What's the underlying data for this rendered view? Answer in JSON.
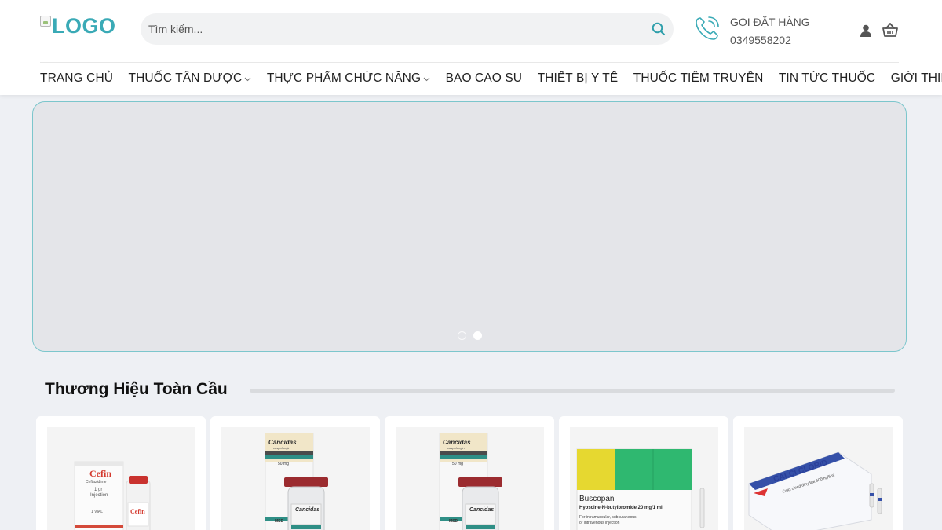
{
  "header": {
    "logo_text": "LOGO",
    "search": {
      "placeholder": "Tìm kiếm..."
    },
    "call": {
      "label": "GỌI ĐẶT HÀNG",
      "phone": "0349558202"
    }
  },
  "nav": [
    {
      "label": "TRANG CHỦ",
      "has_dropdown": false
    },
    {
      "label": "THUỐC TÂN DƯỢC",
      "has_dropdown": true
    },
    {
      "label": "THỰC PHẨM CHỨC NĂNG",
      "has_dropdown": true
    },
    {
      "label": "BAO CAO SU",
      "has_dropdown": false
    },
    {
      "label": "THIẾT BỊ Y TẾ",
      "has_dropdown": false
    },
    {
      "label": "THUỐC TIÊM TRUYỀN",
      "has_dropdown": false
    },
    {
      "label": "TIN TỨC THUỐC",
      "has_dropdown": false
    },
    {
      "label": "GIỚI THIỆU",
      "has_dropdown": false
    }
  ],
  "slider": {
    "slide_count": 2,
    "active_slide": 2
  },
  "section": {
    "title": "Thương Hiệu Toàn Cầu"
  },
  "products": [
    {
      "brand": "Cefin",
      "subtitle": "Ceftazidime",
      "dose": "1 gr",
      "form": "Injection",
      "pack": "1 VIAL"
    },
    {
      "brand": "Cancidas",
      "subtitle": "caspofungin",
      "dose": "50 mg",
      "maker": "MSD"
    },
    {
      "brand": "Cancidas",
      "subtitle": "caspofungin",
      "dose": "50 mg",
      "maker": "MSD"
    },
    {
      "brand": "Buscopan",
      "subtitle": "Hyoscine-N-butylbromide 20 mg/1 ml",
      "note1": "For intramuscular, subcutaneous",
      "note2": "or intravenous injection"
    },
    {
      "brand": "CALCI CLORID",
      "subtitle": "Calci clorid dihydrat 500mg/5ml"
    }
  ],
  "colors": {
    "accent": "#3aaab6",
    "slider_border": "#7cc6cc",
    "page_bg": "#eef0f4"
  },
  "icons": {
    "search": "search-icon",
    "phone": "phone-ringing-icon",
    "user": "user-icon",
    "cart": "cart-basket-icon"
  }
}
